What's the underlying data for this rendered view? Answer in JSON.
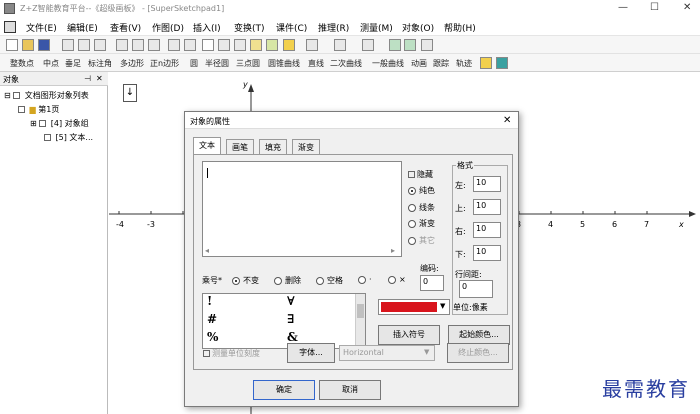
{
  "window": {
    "title": "Z+Z智能教育平台--《超级画板》 - [SuperSketchpad1]",
    "min": "—",
    "max": "☐",
    "close": "✕"
  },
  "menu": [
    "文件(E)",
    "编辑(E)",
    "查看(V)",
    "作图(D)",
    "插入(I)",
    "变换(T)",
    "课件(C)",
    "推理(R)",
    "测量(M)",
    "对象(O)",
    "帮助(H)"
  ],
  "toolbar2": [
    "整数点",
    "中点",
    "垂足",
    "标注角",
    "多边形",
    "正n边形",
    "圆",
    "半径圆",
    "三点圆",
    "圆锥曲线",
    "直线",
    "二次曲线",
    "一般曲线",
    "动画",
    "跟踪",
    "轨迹"
  ],
  "left_panel": {
    "title": "对象",
    "tree": [
      "文档图形对象列表",
      "第1页",
      "[4] 对象组",
      "[5] 文本..."
    ]
  },
  "canvas": {
    "y_label": "y",
    "x_label": "x",
    "x_ticks": [
      "-4",
      "-3",
      "3",
      "4",
      "5",
      "6",
      "7"
    ],
    "toggle_icon": "↓"
  },
  "dialog": {
    "title": "对象的属性",
    "close": "✕",
    "tabs": [
      "文本",
      "画笔",
      "填充",
      "渐变"
    ],
    "options": {
      "hide": "隐藏",
      "solid": "纯色",
      "lines": "线条",
      "gradient": "渐变",
      "other": "其它"
    },
    "format": {
      "group": "格式",
      "left_label": "左:",
      "left": "10",
      "top_label": "上:",
      "top": "10",
      "right_label": "右:",
      "right": "10",
      "bottom_label": "下:",
      "bottom": "10",
      "spacing_label": "行间距:",
      "spacing": "0",
      "unit": "单位:像素"
    },
    "encoding_label": "编码:",
    "encoding_value": "0",
    "multiply_label": "乘号*",
    "multiply_options": [
      "不变",
      "删除",
      "空格",
      "·",
      "×"
    ],
    "symbols": [
      [
        "!",
        "∀"
      ],
      [
        "#",
        "∃"
      ],
      [
        "%",
        "&"
      ]
    ],
    "color": "#d8141c",
    "insert_symbol": "插入符号",
    "start_color": "起始颜色...",
    "end_color": "终止颜色...",
    "scale_check": "测量单位刻度",
    "font_button": "字体...",
    "direction": "Horizontal",
    "ok": "确定",
    "cancel": "取消"
  },
  "watermark": "最需教育"
}
